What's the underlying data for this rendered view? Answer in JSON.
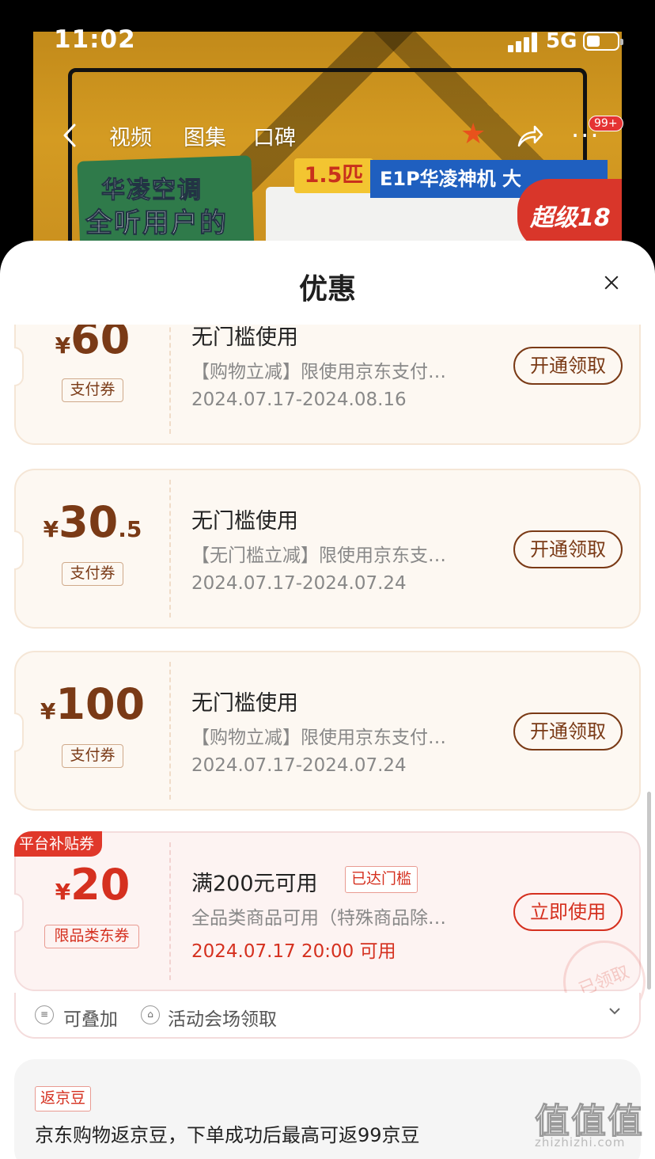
{
  "status_bar": {
    "time": "11:02",
    "network": "5G"
  },
  "product_banner": {
    "headline_line1": "华凌空调",
    "headline_line2": "全听用户的",
    "capacity_badge": "1.5匹",
    "model_badge": "E1P华凌神机 大",
    "promo_badge": "超级18"
  },
  "top_nav": {
    "tabs": [
      "视频",
      "图集",
      "口碑"
    ],
    "more_badge": "99+",
    "star_color": "#e8521c"
  },
  "sheet": {
    "title": "优惠",
    "coupons": [
      {
        "currency": "¥",
        "amount_int": "60",
        "amount_dec": "",
        "type_label": "支付券",
        "title": "无门槛使用",
        "description": "【购物立减】限使用京东支付…",
        "date": "2024.07.17-2024.08.16",
        "action_label": "开通领取"
      },
      {
        "currency": "¥",
        "amount_int": "30",
        "amount_dec": ".5",
        "type_label": "支付券",
        "title": "无门槛使用",
        "description": "【无门槛立减】限使用京东支…",
        "date": "2024.07.17-2024.07.24",
        "action_label": "开通领取"
      },
      {
        "currency": "¥",
        "amount_int": "100",
        "amount_dec": "",
        "type_label": "支付券",
        "title": "无门槛使用",
        "description": "【购物立减】限使用京东支付…",
        "date": "2024.07.17-2024.07.24",
        "action_label": "开通领取"
      },
      {
        "platform_tag": "平台补贴券",
        "currency": "¥",
        "amount_int": "20",
        "amount_dec": "",
        "type_label": "限品类东券",
        "title": "满200元可用",
        "threshold_tag": "已达门槛",
        "description": "全品类商品可用（特殊商品除…",
        "date": "2024.07.17 20:00 可用",
        "action_label": "立即使用",
        "stamp_text": "已领取",
        "accent_color": "#d5301f"
      }
    ],
    "coupon_footer": {
      "stackable_icon": "stack-icon",
      "stackable_label": "可叠加",
      "source_icon": "venue-icon",
      "source_label": "活动会场领取"
    },
    "beans": {
      "tag": "返京豆",
      "text": "京东购物返京豆，下单成功后最高可返99京豆"
    }
  },
  "watermark": {
    "main": "值值值",
    "sub": "zhizhizhi.com"
  }
}
